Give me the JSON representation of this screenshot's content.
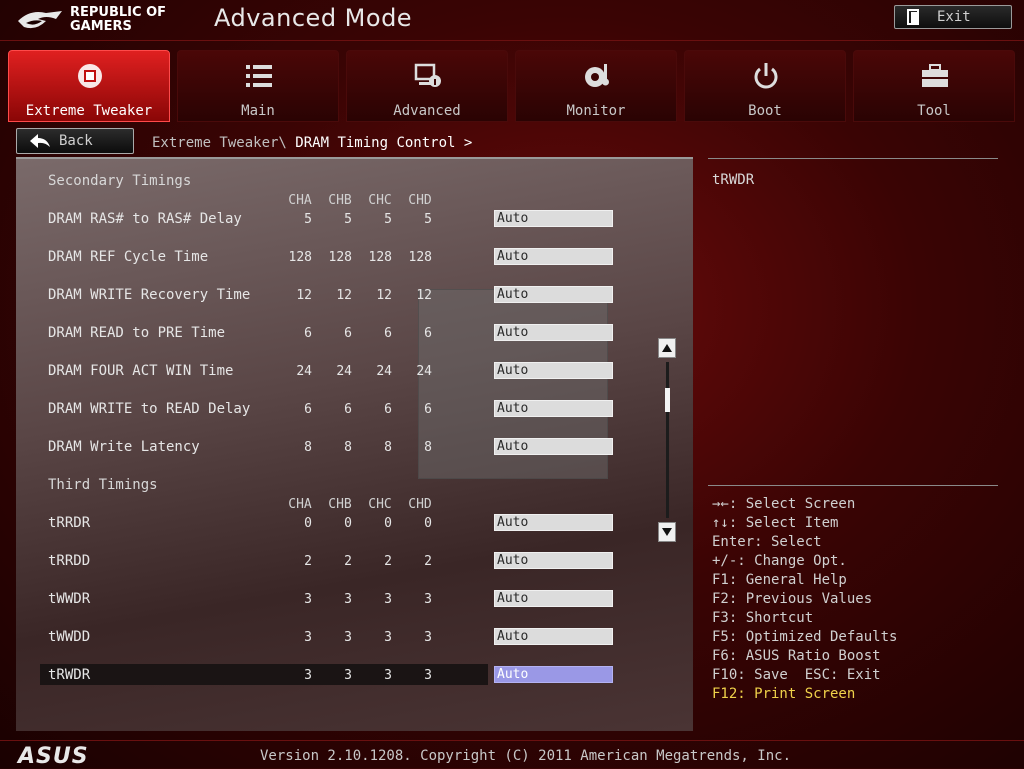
{
  "header": {
    "brand_line1": "REPUBLIC OF",
    "brand_line2": "GAMERS",
    "mode_title": "Advanced Mode",
    "exit_label": "Exit"
  },
  "tabs": [
    {
      "label": "Extreme Tweaker",
      "icon": "tweaker-icon",
      "active": true
    },
    {
      "label": "Main",
      "icon": "list-icon",
      "active": false
    },
    {
      "label": "Advanced",
      "icon": "advanced-icon",
      "active": false
    },
    {
      "label": "Monitor",
      "icon": "monitor-gauge-icon",
      "active": false
    },
    {
      "label": "Boot",
      "icon": "power-icon",
      "active": false
    },
    {
      "label": "Tool",
      "icon": "toolbox-icon",
      "active": false
    }
  ],
  "nav": {
    "back_label": "Back",
    "breadcrumb_parent": "Extreme Tweaker\\",
    "breadcrumb_current": "DRAM Timing Control >"
  },
  "channels": [
    "CHA",
    "CHB",
    "CHC",
    "CHD"
  ],
  "sections": [
    {
      "title": "Secondary Timings",
      "rows": [
        {
          "label": "DRAM RAS# to RAS# Delay",
          "values": [
            "5",
            "5",
            "5",
            "5"
          ],
          "setting": "Auto"
        },
        {
          "label": "DRAM REF Cycle Time",
          "values": [
            "128",
            "128",
            "128",
            "128"
          ],
          "setting": "Auto"
        },
        {
          "label": "DRAM WRITE Recovery Time",
          "values": [
            "12",
            "12",
            "12",
            "12"
          ],
          "setting": "Auto"
        },
        {
          "label": "DRAM READ to PRE Time",
          "values": [
            "6",
            "6",
            "6",
            "6"
          ],
          "setting": "Auto"
        },
        {
          "label": "DRAM FOUR ACT WIN Time",
          "values": [
            "24",
            "24",
            "24",
            "24"
          ],
          "setting": "Auto"
        },
        {
          "label": "DRAM WRITE to READ Delay",
          "values": [
            "6",
            "6",
            "6",
            "6"
          ],
          "setting": "Auto"
        },
        {
          "label": "DRAM Write Latency",
          "values": [
            "8",
            "8",
            "8",
            "8"
          ],
          "setting": "Auto"
        }
      ]
    },
    {
      "title": "Third Timings",
      "rows": [
        {
          "label": "tRRDR",
          "values": [
            "0",
            "0",
            "0",
            "0"
          ],
          "setting": "Auto"
        },
        {
          "label": "tRRDD",
          "values": [
            "2",
            "2",
            "2",
            "2"
          ],
          "setting": "Auto"
        },
        {
          "label": "tWWDR",
          "values": [
            "3",
            "3",
            "3",
            "3"
          ],
          "setting": "Auto"
        },
        {
          "label": "tWWDD",
          "values": [
            "3",
            "3",
            "3",
            "3"
          ],
          "setting": "Auto"
        },
        {
          "label": "tRWDR",
          "values": [
            "3",
            "3",
            "3",
            "3"
          ],
          "setting": "Auto",
          "selected": true
        }
      ]
    }
  ],
  "help": {
    "item": "tRWDR",
    "keys": [
      {
        "text": "→←: Select Screen"
      },
      {
        "text": "↑↓: Select Item"
      },
      {
        "text": "Enter: Select"
      },
      {
        "text": "+/-: Change Opt."
      },
      {
        "text": "F1: General Help"
      },
      {
        "text": "F2: Previous Values"
      },
      {
        "text": "F3: Shortcut"
      },
      {
        "text": "F5: Optimized Defaults"
      },
      {
        "text": "F6: ASUS Ratio Boost"
      },
      {
        "text": "F10: Save  ESC: Exit"
      },
      {
        "text": "F12: Print Screen",
        "highlight": true
      }
    ]
  },
  "footer": {
    "brand": "ASUS",
    "version": "Version 2.10.1208. Copyright (C) 2011 American Megatrends, Inc."
  },
  "colors": {
    "accent_red": "#e02020",
    "selected_value": "#9a98e6",
    "highlight_key": "#f0d24a"
  }
}
